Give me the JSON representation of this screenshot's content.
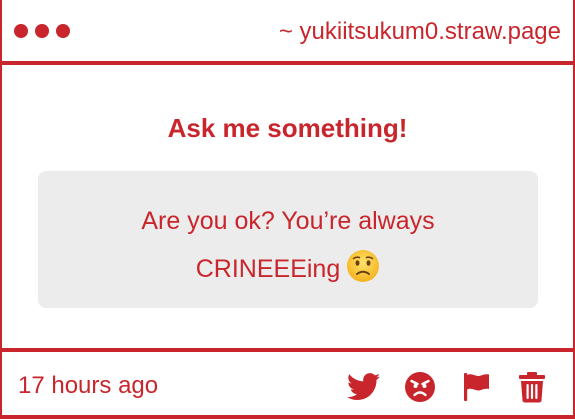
{
  "header": {
    "url": "~ yukiitsukum0.straw.page"
  },
  "main": {
    "heading": "Ask me something!",
    "question_line1": "Are you ok? You’re always",
    "question_line2": "CRINEEEing"
  },
  "footer": {
    "time": "17 hours ago",
    "icons": [
      "twitter-icon",
      "angry-face-icon",
      "flag-icon",
      "trash-icon"
    ]
  },
  "colors": {
    "accent": "#c8262c",
    "box_bg": "#ececec"
  }
}
